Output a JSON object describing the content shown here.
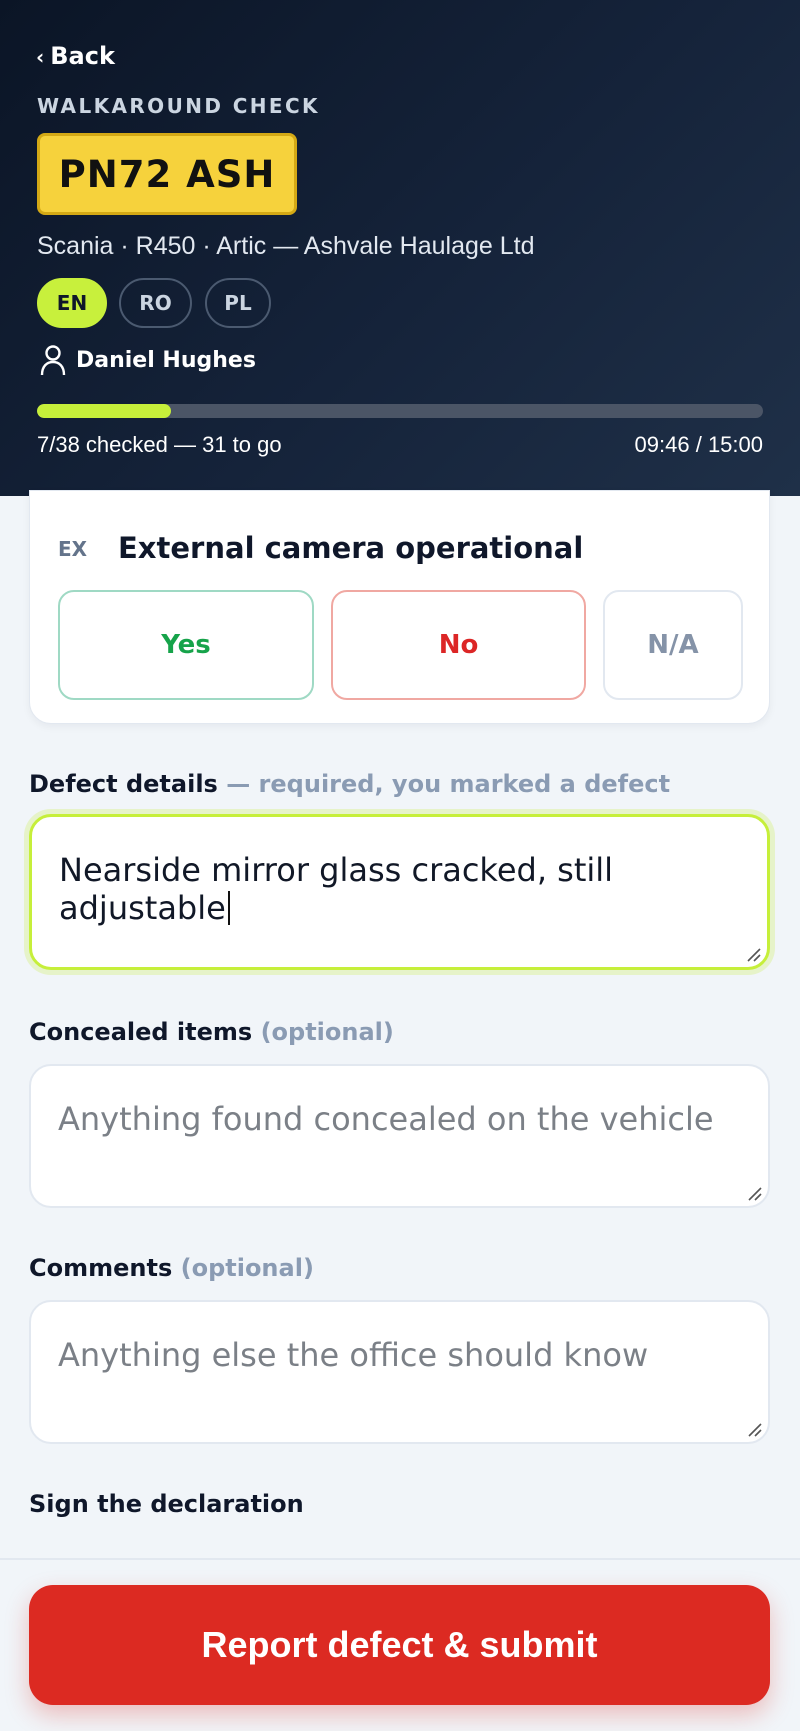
{
  "header": {
    "back_label": "Back",
    "eyebrow": "WALKAROUND CHECK",
    "plate": "PN72 ASH",
    "vehicle_line": "Scania · R450 · Artic — Ashvale Haulage Ltd",
    "languages": [
      {
        "code": "EN",
        "active": true
      },
      {
        "code": "RO",
        "active": false
      },
      {
        "code": "PL",
        "active": false
      }
    ],
    "driver_name": "Daniel Hughes",
    "progress": {
      "checked": 7,
      "total": 38,
      "fraction": 0.184,
      "text": "7/38 checked — 31 to go"
    },
    "timer": "09:46 / 15:00"
  },
  "question": {
    "code": "EX",
    "title": "External camera operational",
    "answers": {
      "yes": "Yes",
      "no": "No",
      "na": "N/A"
    }
  },
  "defect": {
    "label": "Defect details",
    "hint": "— required, you marked a defect",
    "value": "Nearside mirror glass cracked, still adjustable"
  },
  "concealed": {
    "label": "Concealed items",
    "hint": "(optional)",
    "placeholder": "Anything found concealed on the vehicle"
  },
  "comments": {
    "label": "Comments",
    "hint": "(optional)",
    "placeholder": "Anything else the office should know"
  },
  "declaration": {
    "label": "Sign the declaration"
  },
  "submit": {
    "label": "Report defect & submit"
  },
  "colors": {
    "header_bg": "#0f1b2e",
    "accent": "#c6ef3a",
    "plate_yellow": "#f6d23c",
    "danger": "#dc2a22",
    "success": "#16a34a"
  },
  "icons": {
    "back": "chevron-left-icon",
    "driver": "user-icon",
    "resize": "resize-grip-icon"
  }
}
